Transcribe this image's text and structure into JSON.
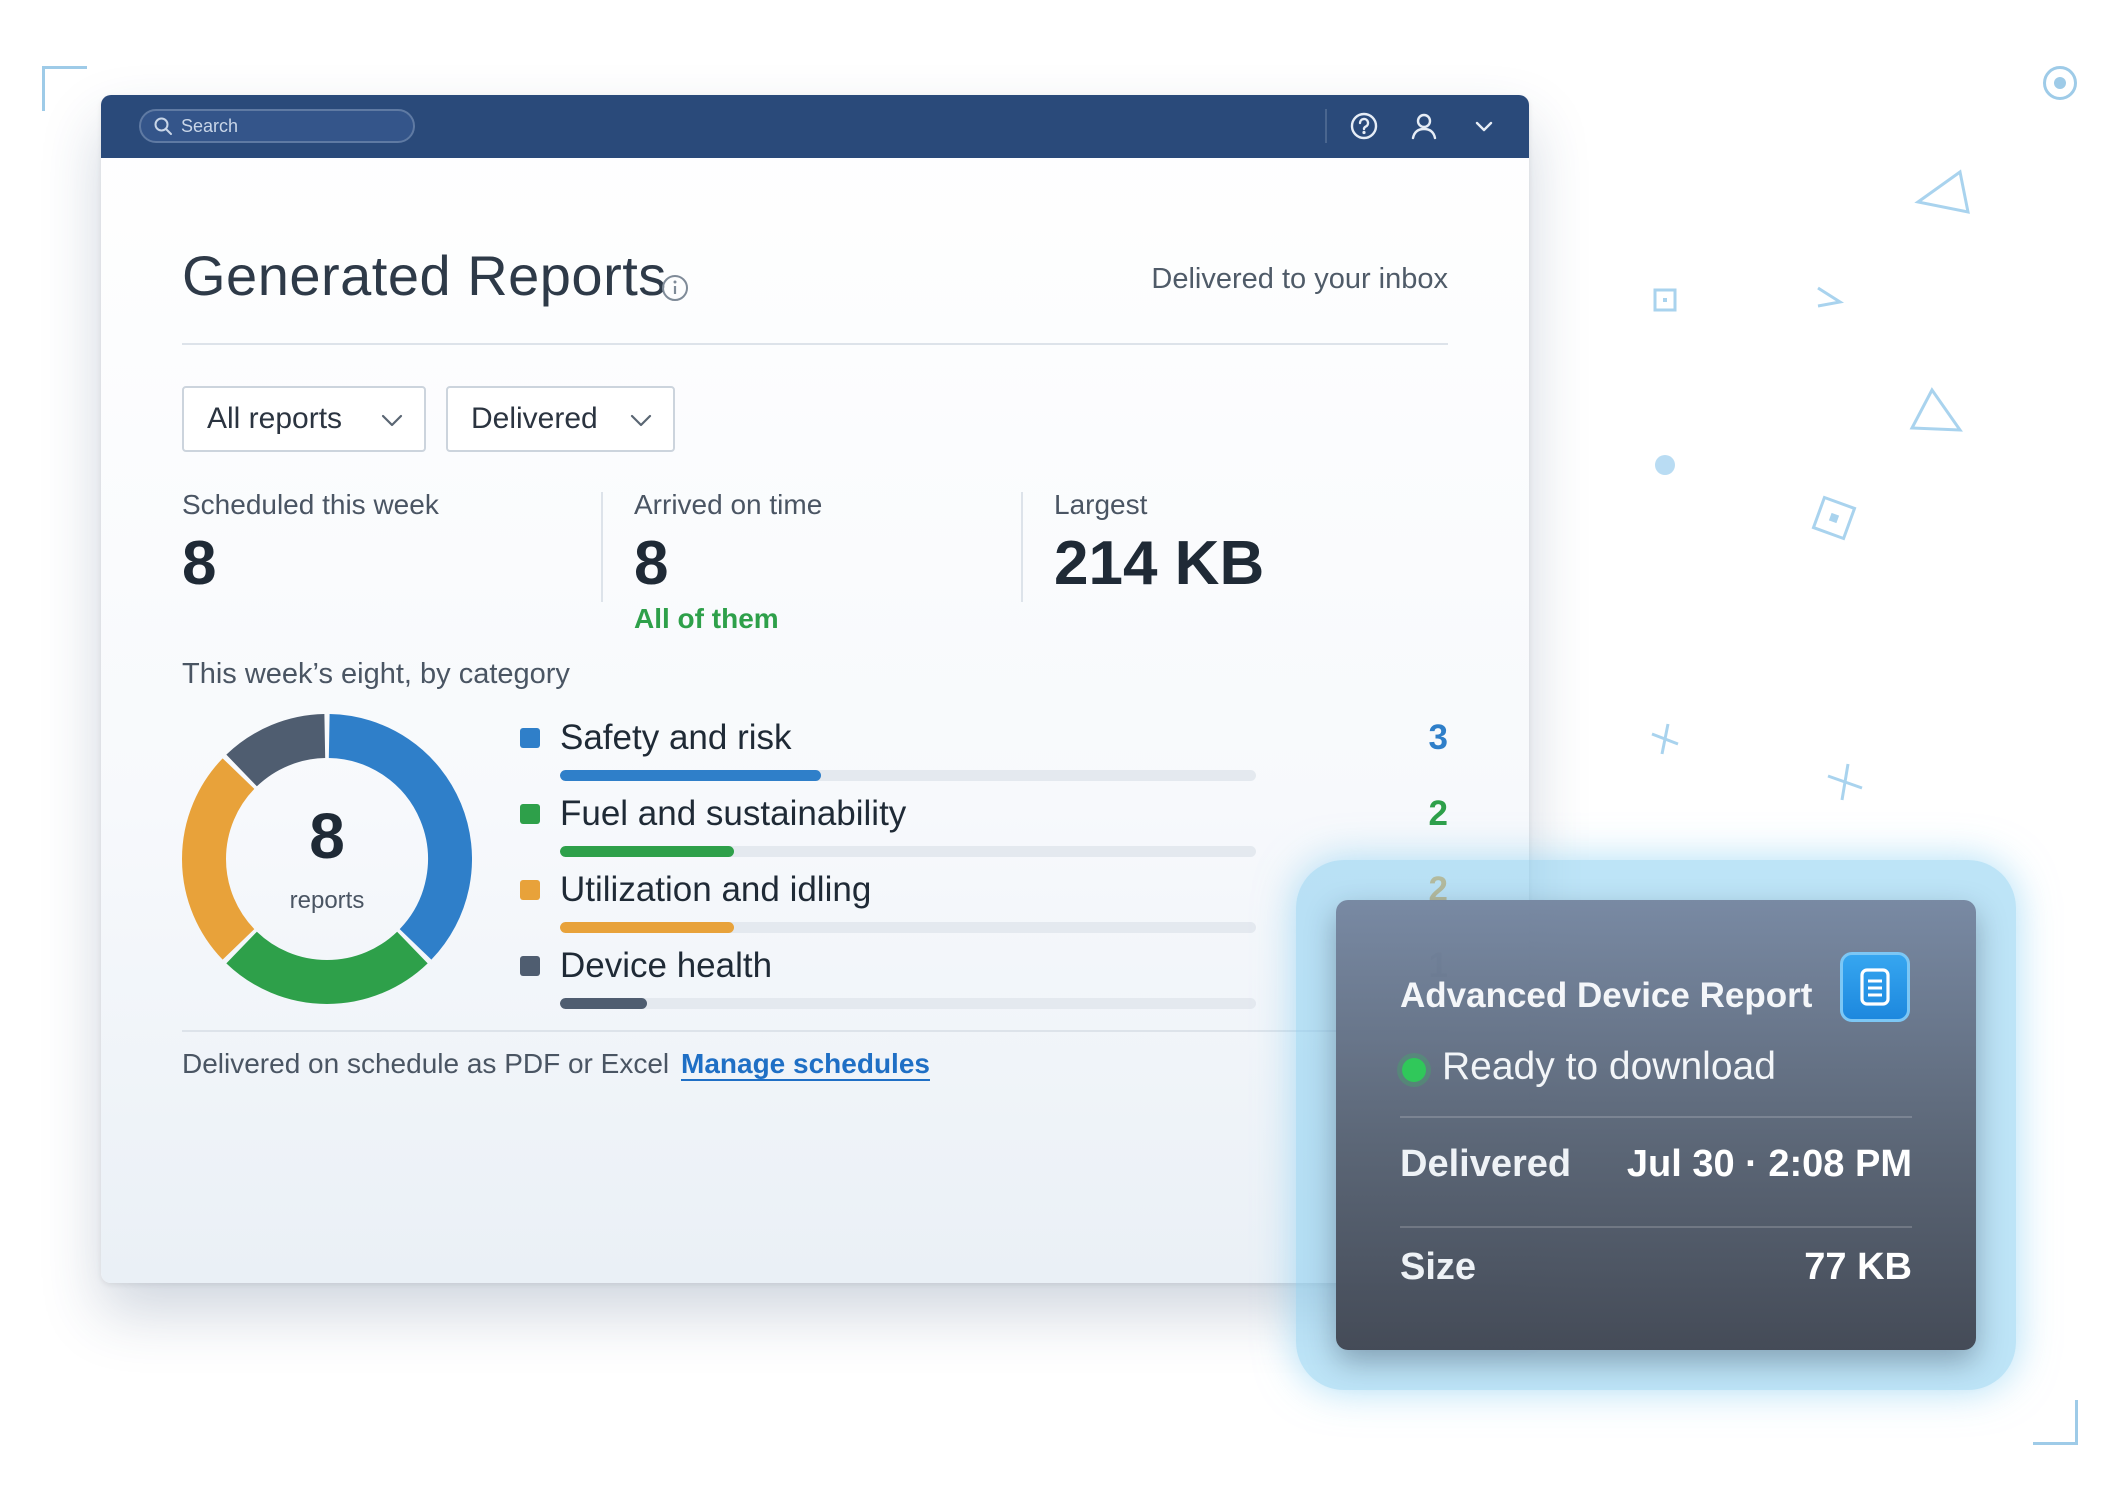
{
  "topbar": {
    "search_placeholder": "Search",
    "icons": [
      "search-icon",
      "help-icon",
      "user-icon",
      "chevron-down-icon"
    ]
  },
  "header": {
    "title": "Generated Reports",
    "subtitle": "Delivered to your inbox"
  },
  "filters": {
    "report_type": "All reports",
    "status": "Delivered"
  },
  "stats": [
    {
      "label": "Scheduled this week",
      "value": "8",
      "sub": ""
    },
    {
      "label": "Arrived on time",
      "value": "8",
      "sub": "All of them"
    },
    {
      "label": "Largest",
      "value": "214 KB",
      "sub": ""
    }
  ],
  "categories": {
    "heading": "This week’s eight, by category",
    "total": "8",
    "total_unit": "reports",
    "items": [
      {
        "name": "Safety and risk",
        "count": 3,
        "color": "#2f7fc9"
      },
      {
        "name": "Fuel and sustainability",
        "count": 2,
        "color": "#2ea04a"
      },
      {
        "name": "Utilization and idling",
        "count": 2,
        "color": "#e8a23a"
      },
      {
        "name": "Device health",
        "count": 1,
        "color": "#4f5d70"
      }
    ],
    "bar_max": 8
  },
  "footer": {
    "note": "Delivered on schedule as PDF or Excel",
    "link": "Manage schedules"
  },
  "card": {
    "title": "Advanced Device Report",
    "status": "Ready to download",
    "rows": [
      {
        "label": "Delivered",
        "value": "Jul 30 · 2:08 PM"
      },
      {
        "label": "Size",
        "value": "77 KB"
      }
    ],
    "accent": "#1d88de",
    "status_color": "#30c85a"
  },
  "colors": {
    "topbar": "#2a4a7a",
    "link": "#1f6fc5",
    "positive": "#2ea04a"
  }
}
